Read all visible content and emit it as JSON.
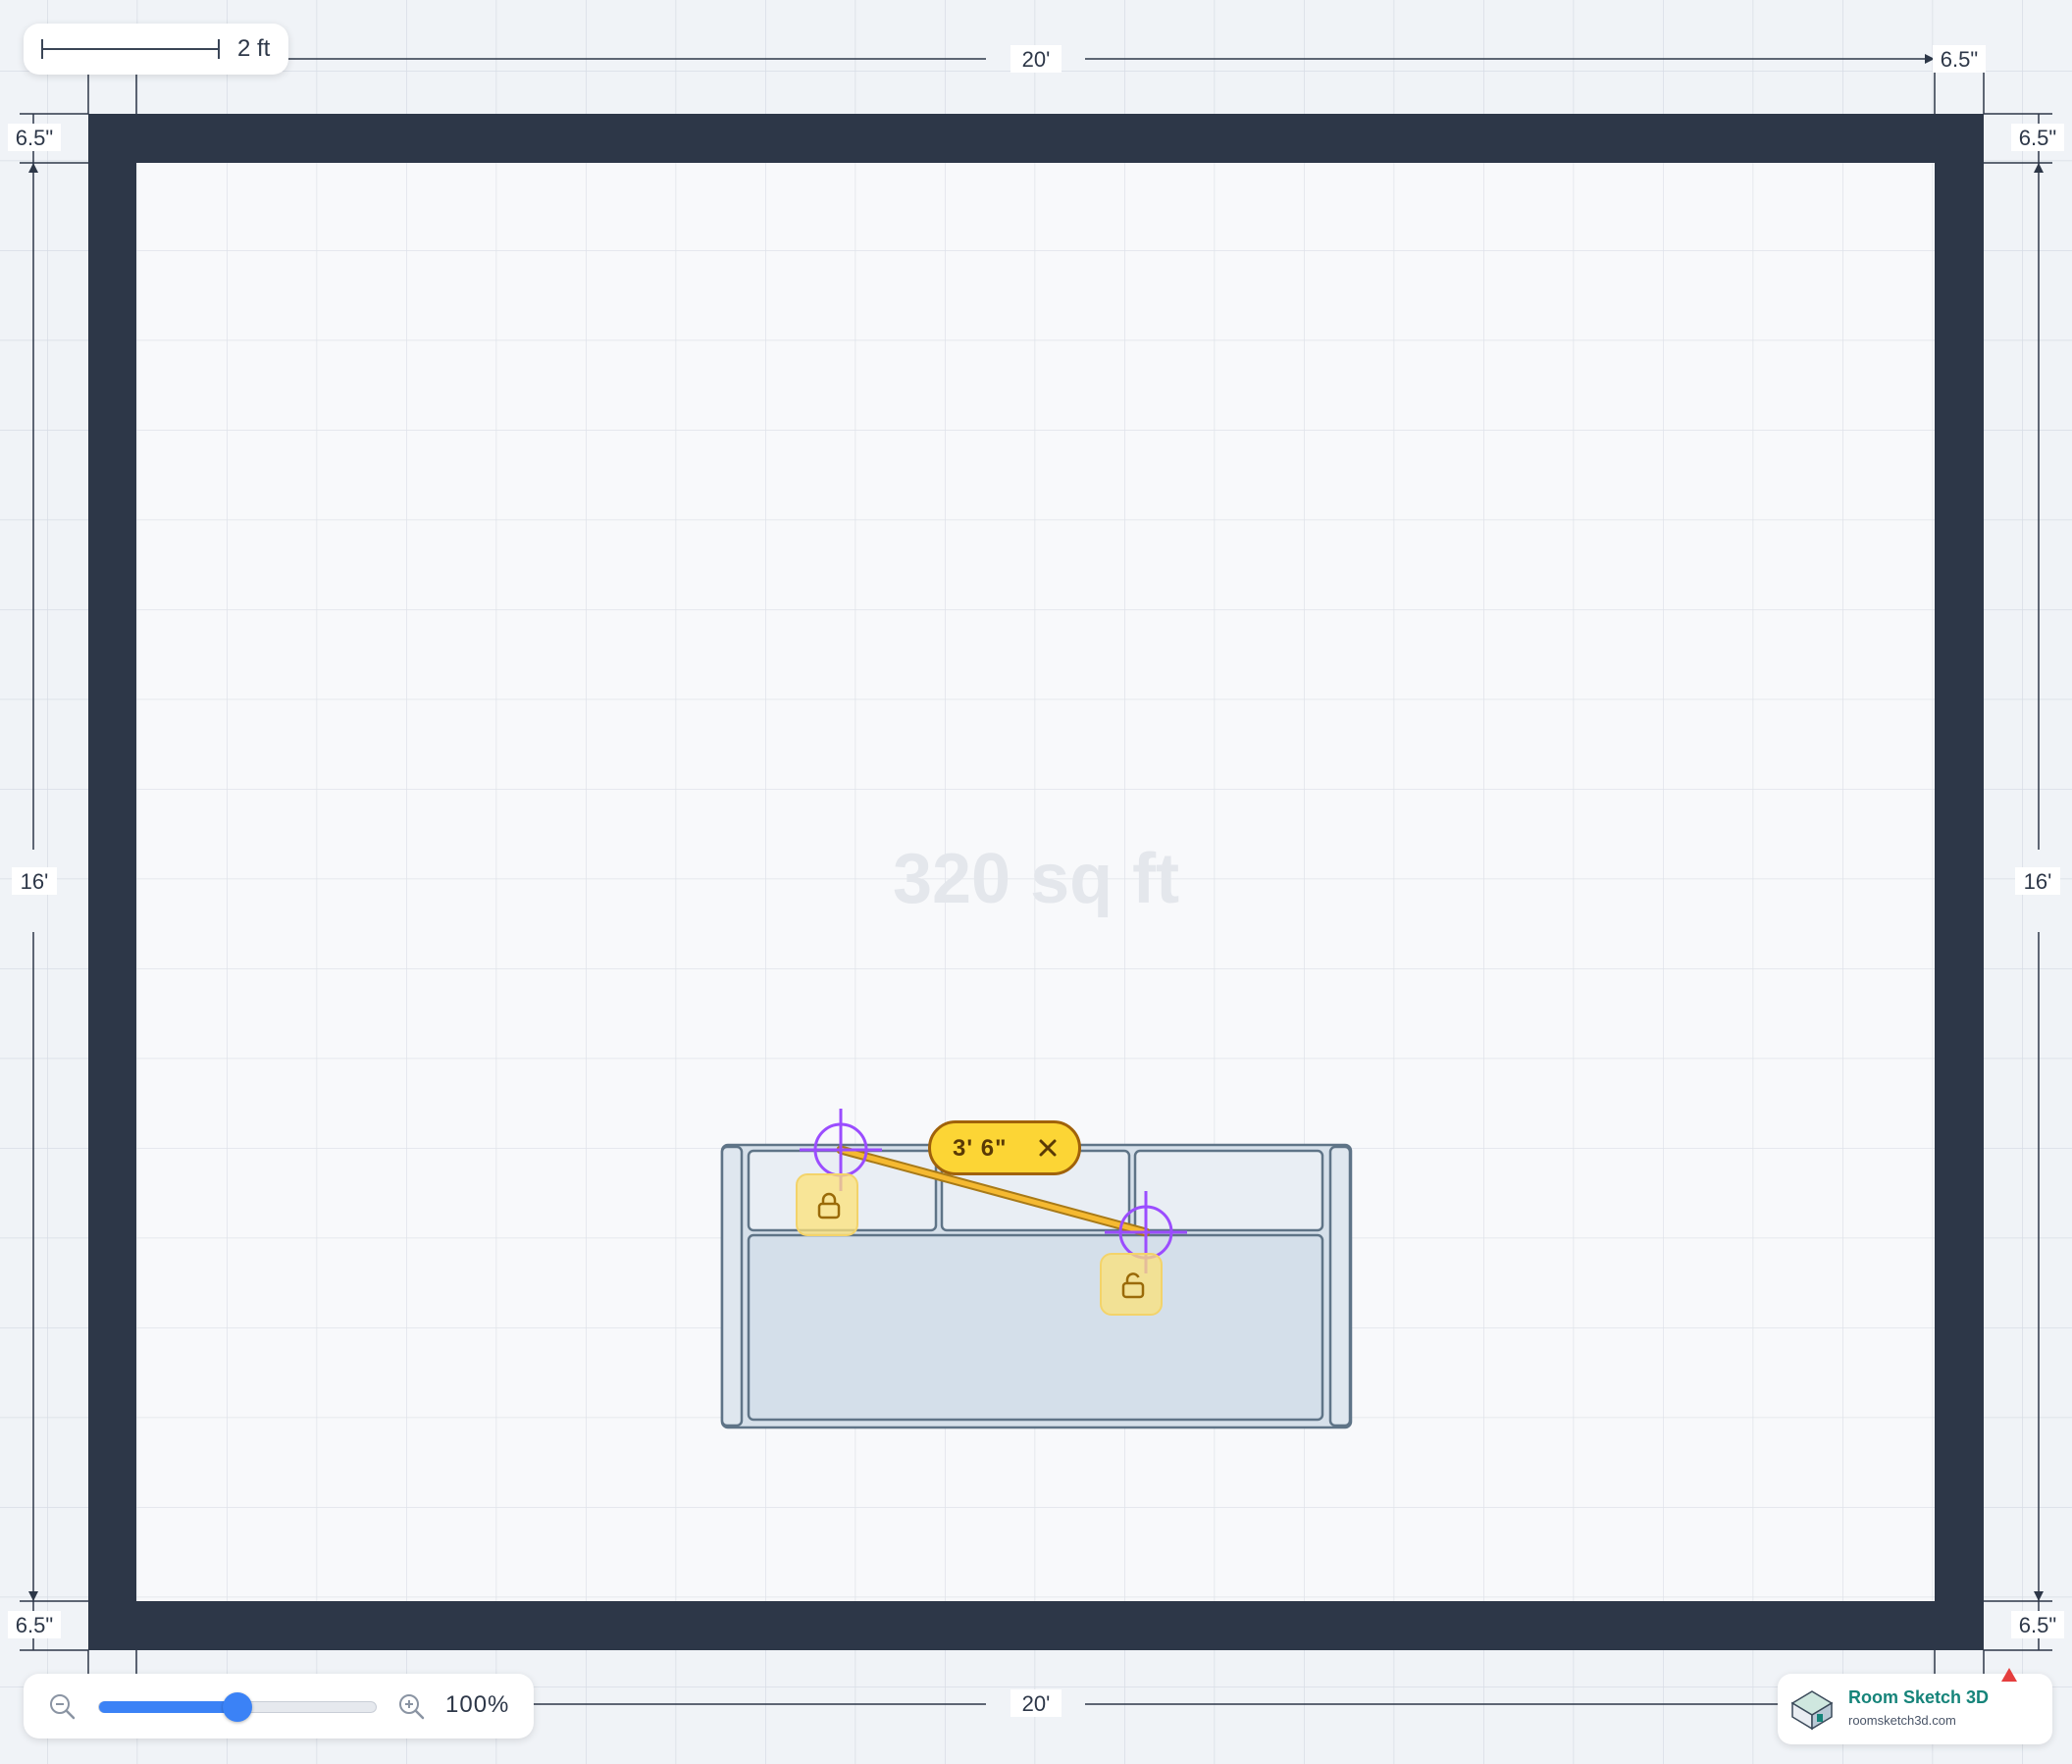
{
  "canvas": {
    "scale_bar_label": "2 ft",
    "area_label": "320 sq ft",
    "dimensions": {
      "top_length": "20'",
      "bottom_length": "20'",
      "left_height": "16'",
      "right_height": "16'",
      "wall_thickness_top_right": "6.5\"",
      "wall_thickness_left_top": "6.5\"",
      "wall_thickness_right_top": "6.5\"",
      "wall_thickness_left_bottom": "6.5\"",
      "wall_thickness_right_bottom": "6.5\""
    }
  },
  "furniture": {
    "sofa": {
      "name": "sofa"
    }
  },
  "measurement": {
    "value": "3' 6\"",
    "close_icon": "close-icon",
    "point_a_lock_icon": "lock-closed-icon",
    "point_b_lock_icon": "lock-open-icon"
  },
  "zoom": {
    "level_label": "100%",
    "level_fraction": 0.5,
    "zoom_out_icon": "zoom-out-icon",
    "zoom_in_icon": "zoom-in-icon"
  },
  "brand": {
    "name": "Room Sketch 3D",
    "url": "roomsketch3d.com"
  },
  "colors": {
    "wall": "#2d3748",
    "accent": "#3b82f6",
    "measure_line": "#f5b931",
    "crosshair": "#9b4dff",
    "brand": "#16847a"
  }
}
